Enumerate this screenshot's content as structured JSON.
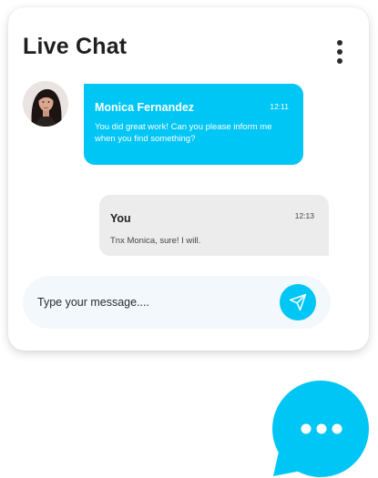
{
  "header": {
    "title": "Live Chat",
    "menu_icon": "more-vertical-icon"
  },
  "messages": [
    {
      "sender": "Monica Fernandez",
      "time": "12:11",
      "text": "You did great work! Can you please inform me when you find something?",
      "avatar": "user-avatar",
      "bubble_color": "#00c6f5"
    },
    {
      "sender": "You",
      "time": "12:13",
      "text": "Tnx Monica, sure! I will.",
      "bubble_color": "#ececec"
    }
  ],
  "composer": {
    "placeholder": "Type your message....",
    "value": "",
    "send_icon": "send-icon"
  },
  "fab": {
    "icon": "chat-bubble-icon"
  },
  "colors": {
    "accent": "#00c6f5",
    "title": "#1f1f1f",
    "outgoing_bubble": "#ececec",
    "composer_bg": "#f3f8fd"
  }
}
